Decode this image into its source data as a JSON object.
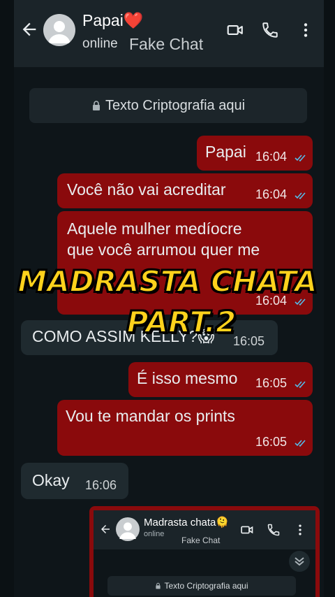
{
  "header": {
    "contact_name": "Papai❤️",
    "status": "online",
    "watermark": "Fake Chat"
  },
  "chat": {
    "encryption_notice": "Texto Criptografia aqui",
    "messages": [
      {
        "direction": "out",
        "text": "Papai",
        "time": "16:04",
        "read": true
      },
      {
        "direction": "out",
        "text": "Você não vai acreditar",
        "time": "16:04",
        "read": true
      },
      {
        "direction": "out",
        "text": "Aquele mulher medíocre\nque você arrumou quer me",
        "time": "16:04",
        "read": true
      },
      {
        "direction": "in",
        "text": "COMO ASSIM KELLY?😱",
        "time": "16:05"
      },
      {
        "direction": "out",
        "text": "É isso mesmo",
        "time": "16:05",
        "read": true
      },
      {
        "direction": "out",
        "text": "Vou te mandar os prints",
        "time": "16:05",
        "read": true
      },
      {
        "direction": "in",
        "text": "Okay",
        "time": "16:06"
      }
    ]
  },
  "overlay": {
    "line1": "MADRASTA CHATA",
    "line2": "PART.2"
  },
  "screenshot": {
    "contact_name": "Madrasta chata🫠",
    "status": "online",
    "watermark": "Fake Chat",
    "encryption_notice": "Texto Criptografia aqui"
  },
  "colors": {
    "outgoing_bubble": "#8a0a0c",
    "incoming_bubble": "#1f2a2f",
    "read_ticks": "#53bdeb",
    "overlay_text": "#ffd21c"
  }
}
